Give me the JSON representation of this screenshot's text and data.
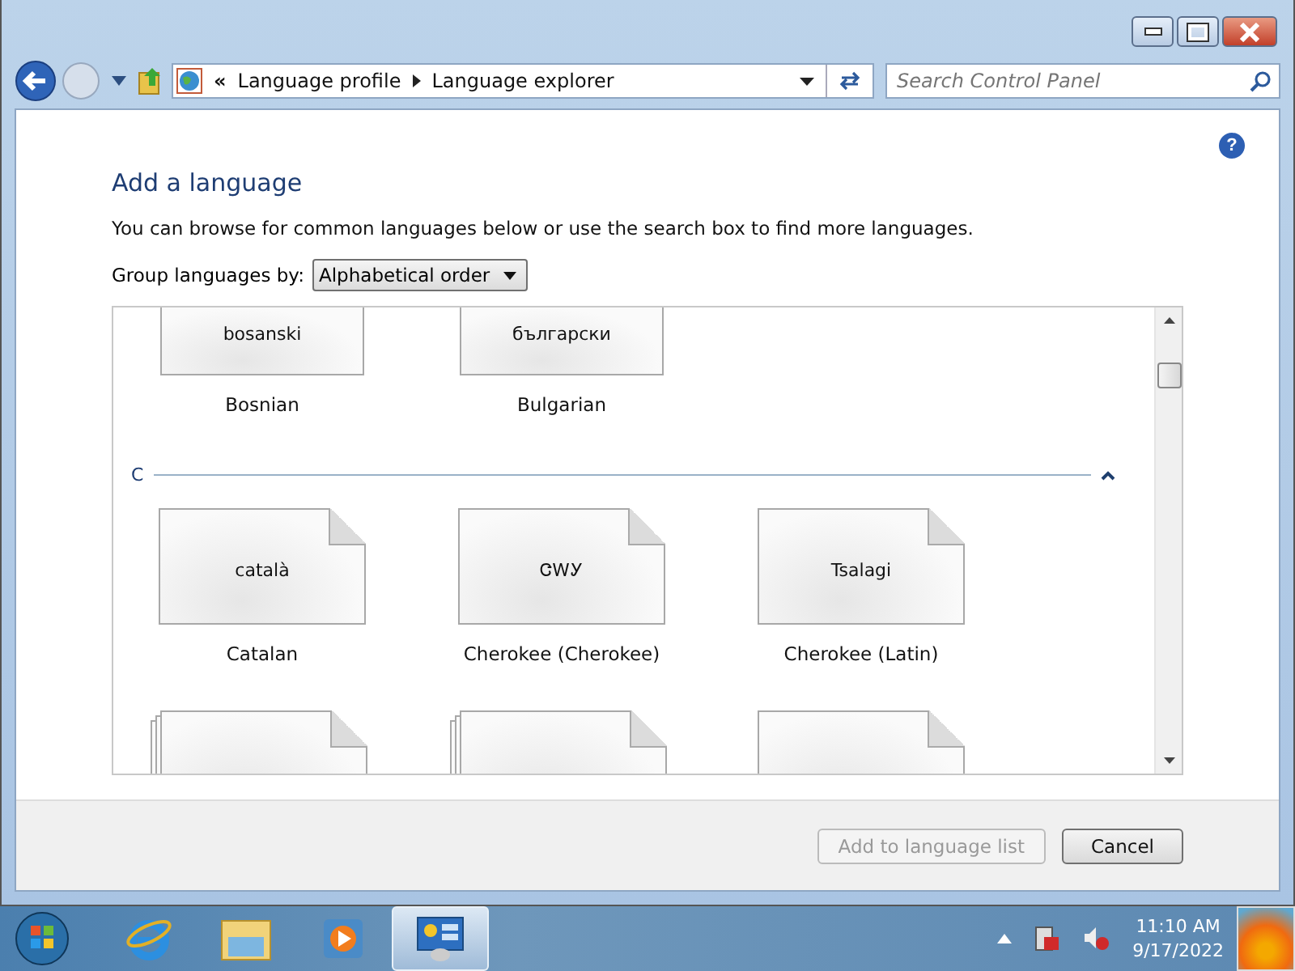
{
  "address_bar": {
    "overflow": "«",
    "crumbs": [
      "Language profile",
      "Language explorer"
    ]
  },
  "search": {
    "placeholder": "Search Control Panel"
  },
  "help": "?",
  "title": "Add a language",
  "description": "You can browse for common languages below or use the search box to find more languages.",
  "group_by": {
    "label": "Group languages by:",
    "value": "Alphabetical order"
  },
  "top_tiles": [
    {
      "native": "bosanski",
      "name": "Bosnian"
    },
    {
      "native": "български",
      "name": "Bulgarian"
    }
  ],
  "sections": [
    {
      "letter": "C",
      "expanded": true,
      "tiles": [
        {
          "native": "català",
          "name": "Catalan"
        },
        {
          "native": "ᏣᎳᎩ",
          "name": "Cherokee (Cherokee)"
        },
        {
          "native": "Tsalagi",
          "name": "Cherokee (Latin)"
        }
      ],
      "partial_tiles": [
        {
          "kind": "stacked"
        },
        {
          "kind": "stacked"
        },
        {
          "kind": "single"
        }
      ]
    }
  ],
  "buttons": [
    {
      "label": "Add to language list",
      "disabled": true
    },
    {
      "label": "Cancel",
      "disabled": false
    }
  ],
  "taskbar": {
    "apps": [
      {
        "kind": "browser",
        "selected": false
      },
      {
        "kind": "folder",
        "selected": false
      },
      {
        "kind": "media",
        "selected": false
      },
      {
        "kind": "control-panel",
        "selected": true
      }
    ],
    "time": "11:10 AM",
    "date": "9/17/2022"
  }
}
